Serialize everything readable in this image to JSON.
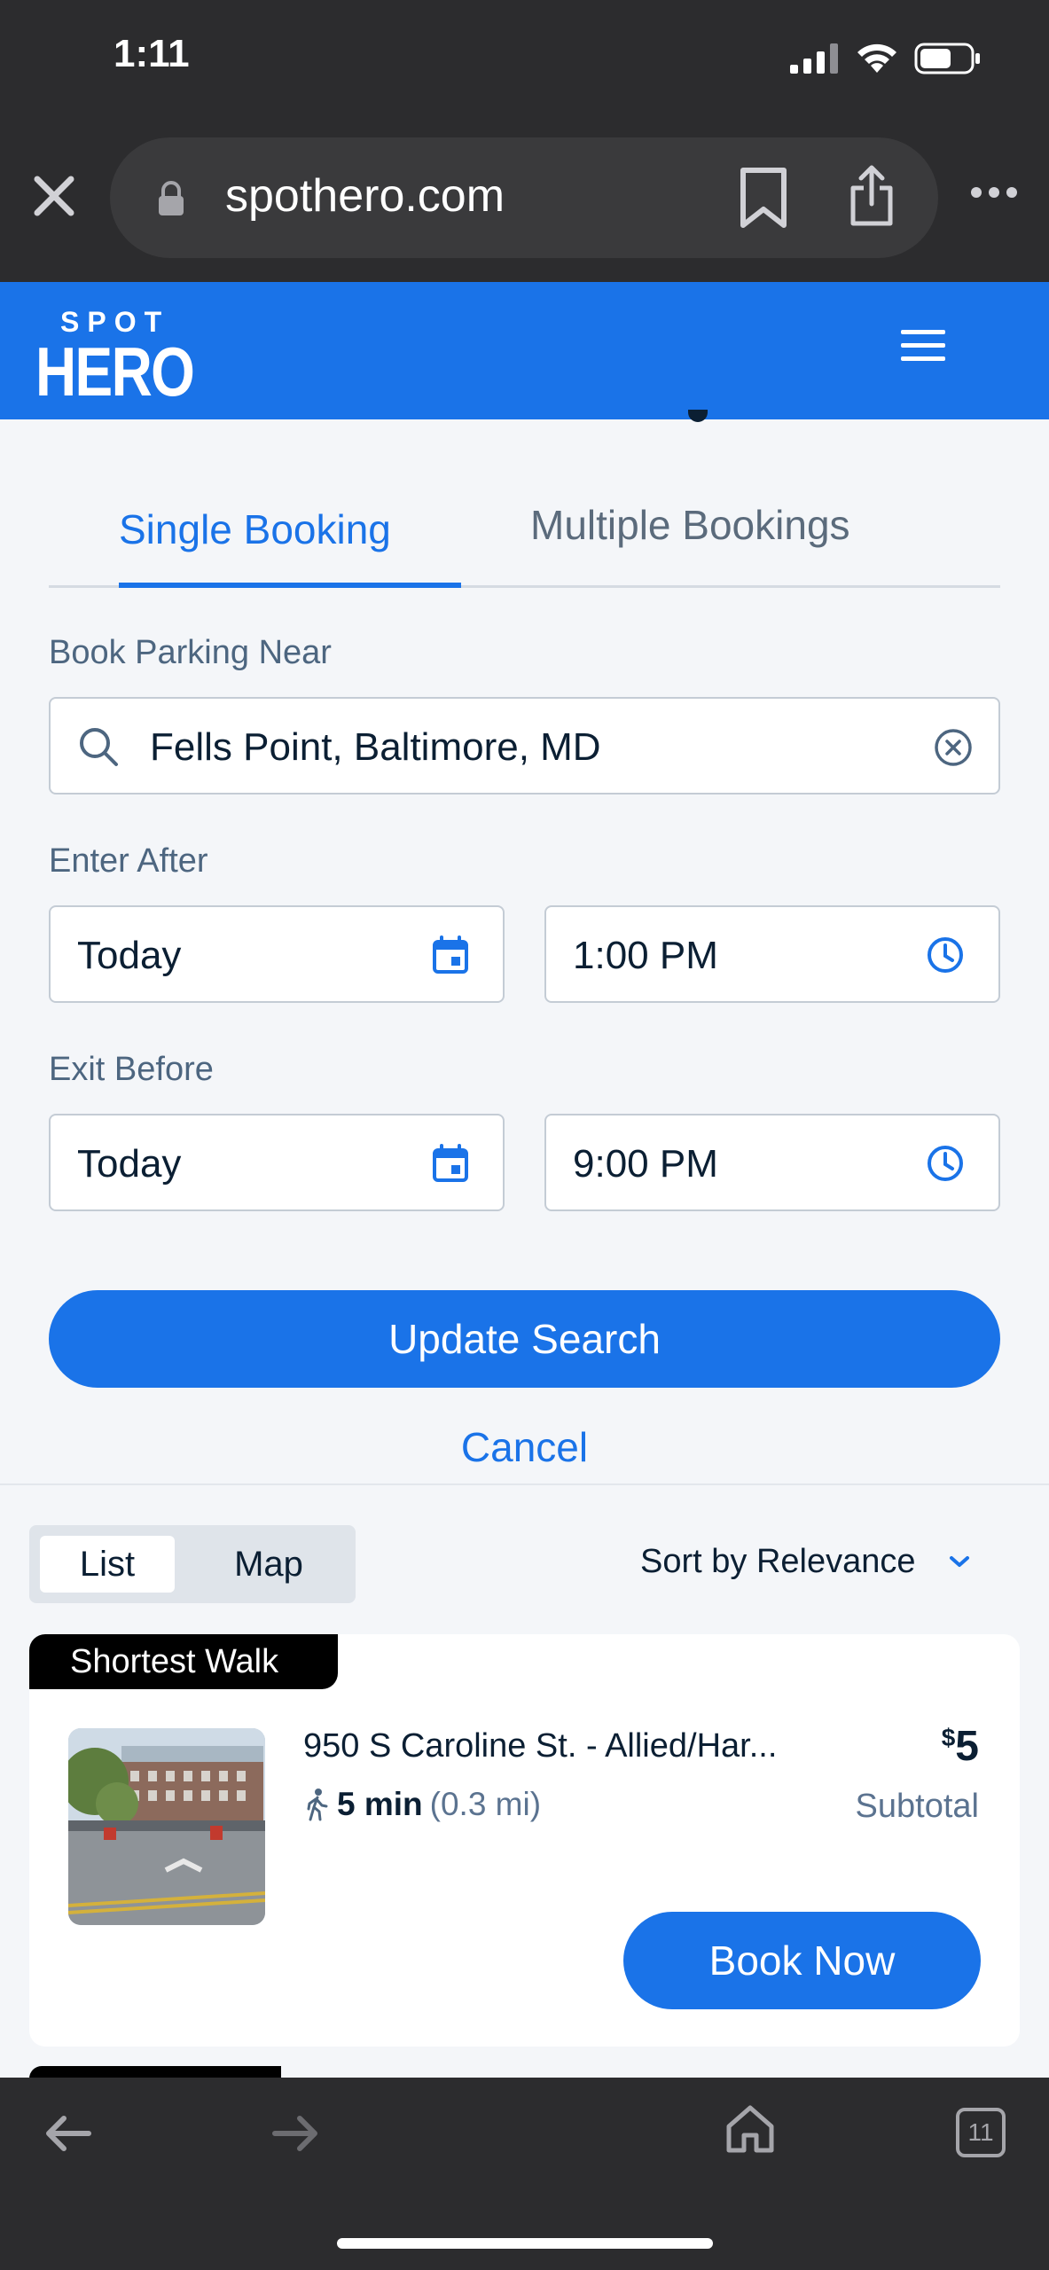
{
  "status_bar": {
    "time": "1:11"
  },
  "browser": {
    "url": "spothero.com",
    "tab_count": "11"
  },
  "header": {
    "logo_top": "SPOT",
    "logo_bottom": "HERO"
  },
  "booking_tabs": {
    "single": "Single Booking",
    "multiple": "Multiple Bookings"
  },
  "form": {
    "location_label": "Book Parking Near",
    "location_value": "Fells Point, Baltimore, MD",
    "enter_label": "Enter After",
    "enter_date": "Today",
    "enter_time": "1:00 PM",
    "exit_label": "Exit Before",
    "exit_date": "Today",
    "exit_time": "9:00 PM",
    "update_button": "Update Search",
    "cancel_link": "Cancel"
  },
  "results": {
    "view_list": "List",
    "view_map": "Map",
    "sort_label": "Sort by Relevance",
    "listing": {
      "badge": "Shortest Walk",
      "address": "950 S Caroline St. - Allied/Har...",
      "walk_time": "5 min",
      "walk_distance": "(0.3 mi)",
      "price_symbol": "$",
      "price": "5",
      "price_note": "Subtotal",
      "book_button": "Book Now"
    }
  },
  "colors": {
    "brand_blue": "#1a73e8",
    "chrome_dark": "#2c2c2e"
  }
}
